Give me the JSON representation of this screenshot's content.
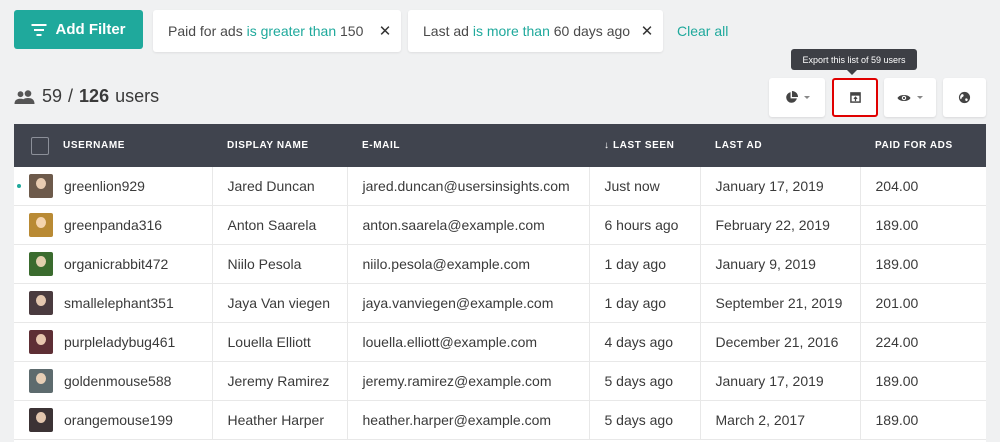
{
  "toolbar": {
    "add_filter_label": "Add Filter",
    "clear_all_label": "Clear all"
  },
  "filters": [
    {
      "field": "Paid for ads",
      "operator": "is greater than",
      "value": "150",
      "remove": "✕"
    },
    {
      "field": "Last ad",
      "operator": "is more than",
      "value": "60 days ago",
      "remove": "✕"
    }
  ],
  "tooltip": "Export this list of 59 users",
  "summary": {
    "filtered": "59",
    "separator": "/",
    "total": "126",
    "unit": "users"
  },
  "view_buttons": [
    {
      "icon": "pie-chart-icon"
    },
    {
      "icon": "export-icon"
    },
    {
      "icon": "eye-icon"
    },
    {
      "icon": "globe-icon"
    }
  ],
  "colors": {
    "accent": "#1fa99c",
    "header_bg": "#40444e",
    "highlight": "#e00000"
  },
  "table": {
    "columns": [
      "USERNAME",
      "DISPLAY NAME",
      "E-MAIL",
      "↓ LAST SEEN",
      "LAST AD",
      "PAID FOR ADS"
    ],
    "rows": [
      {
        "username": "greenlion929",
        "display_name": "Jared Duncan",
        "email": "jared.duncan@usersinsights.com",
        "last_seen": "Just now",
        "last_ad": "January 17, 2019",
        "paid": "204.00",
        "online": true,
        "avatar_color": "#6d5a4b"
      },
      {
        "username": "greenpanda316",
        "display_name": "Anton Saarela",
        "email": "anton.saarela@example.com",
        "last_seen": "6 hours ago",
        "last_ad": "February 22, 2019",
        "paid": "189.00",
        "online": false,
        "avatar_color": "#b98a34"
      },
      {
        "username": "organicrabbit472",
        "display_name": "Niilo Pesola",
        "email": "niilo.pesola@example.com",
        "last_seen": "1 day ago",
        "last_ad": "January 9, 2019",
        "paid": "189.00",
        "online": false,
        "avatar_color": "#3a6b2e"
      },
      {
        "username": "smallelephant351",
        "display_name": "Jaya Van viegen",
        "email": "jaya.vanviegen@example.com",
        "last_seen": "1 day ago",
        "last_ad": "September 21, 2019",
        "paid": "201.00",
        "online": false,
        "avatar_color": "#4a3b3f"
      },
      {
        "username": "purpleladybug461",
        "display_name": "Louella Elliott",
        "email": "louella.elliott@example.com",
        "last_seen": "4 days ago",
        "last_ad": "December 21, 2016",
        "paid": "224.00",
        "online": false,
        "avatar_color": "#5e2f35"
      },
      {
        "username": "goldenmouse588",
        "display_name": "Jeremy Ramirez",
        "email": "jeremy.ramirez@example.com",
        "last_seen": "5 days ago",
        "last_ad": "January 17, 2019",
        "paid": "189.00",
        "online": false,
        "avatar_color": "#5d6b6e"
      },
      {
        "username": "orangemouse199",
        "display_name": "Heather Harper",
        "email": "heather.harper@example.com",
        "last_seen": "5 days ago",
        "last_ad": "March 2, 2017",
        "paid": "189.00",
        "online": false,
        "avatar_color": "#3c3335"
      }
    ]
  }
}
